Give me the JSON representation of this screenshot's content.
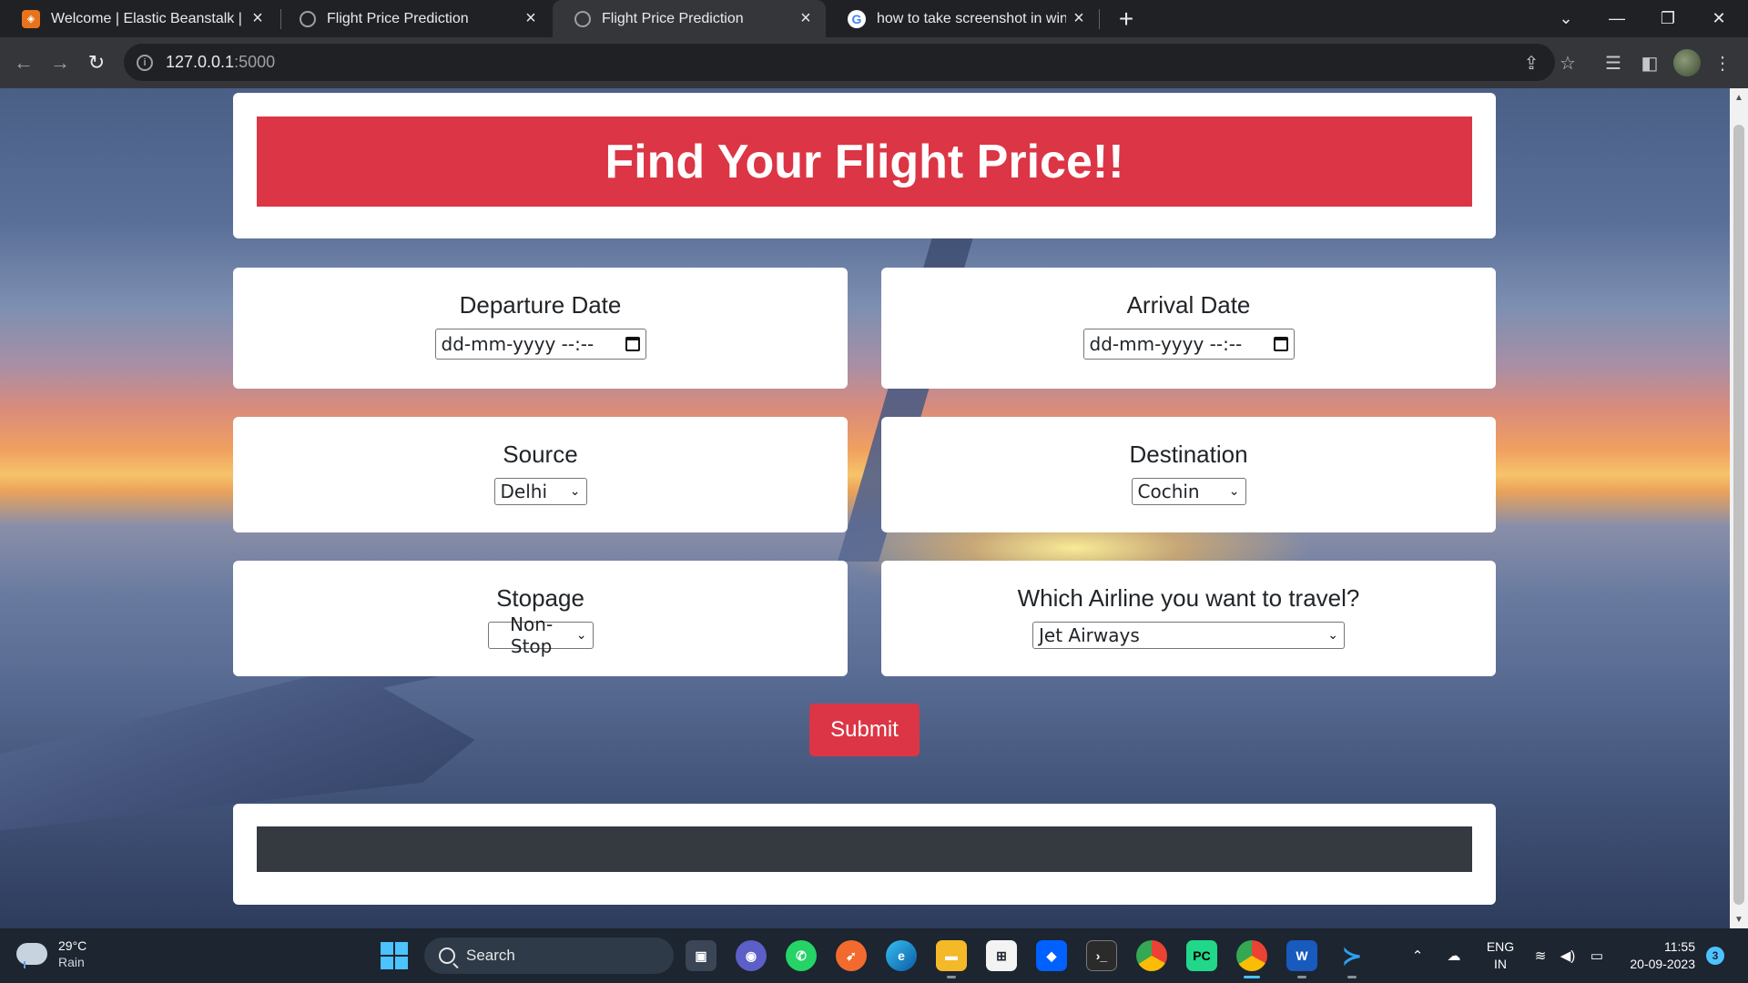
{
  "browser": {
    "tabs": [
      {
        "title": "Welcome | Elastic Beanstalk | eu-",
        "icon": "aws-icon"
      },
      {
        "title": "Flight Price Prediction",
        "icon": "globe-icon"
      },
      {
        "title": "Flight Price Prediction",
        "icon": "globe-icon",
        "active": true
      },
      {
        "title": "how to take screenshot in windo",
        "icon": "google-icon"
      }
    ],
    "new_tab": "+",
    "close": "×",
    "address": {
      "host": "127.0.0.1",
      "port": ":5000"
    }
  },
  "page": {
    "title": "Find Your Flight Price!!",
    "departure": {
      "label": "Departure Date",
      "value": "dd-mm-yyyy --:--"
    },
    "arrival": {
      "label": "Arrival Date",
      "value": "dd-mm-yyyy --:--"
    },
    "source": {
      "label": "Source",
      "value": "Delhi"
    },
    "destination": {
      "label": "Destination",
      "value": "Cochin"
    },
    "stopage": {
      "label": "Stopage",
      "value": "Non-Stop"
    },
    "airline": {
      "label": "Which Airline you want to travel?",
      "value": "Jet Airways"
    },
    "submit_label": "Submit"
  },
  "taskbar": {
    "weather": {
      "temp": "29°C",
      "condition": "Rain"
    },
    "search_label": "Search",
    "language": {
      "line1": "ENG",
      "line2": "IN"
    },
    "time": "11:55",
    "date": "20-09-2023",
    "notifications": "3"
  },
  "colors": {
    "banner": "#dc3545",
    "result_bar": "#343a40",
    "taskbar": "#1c2530"
  }
}
